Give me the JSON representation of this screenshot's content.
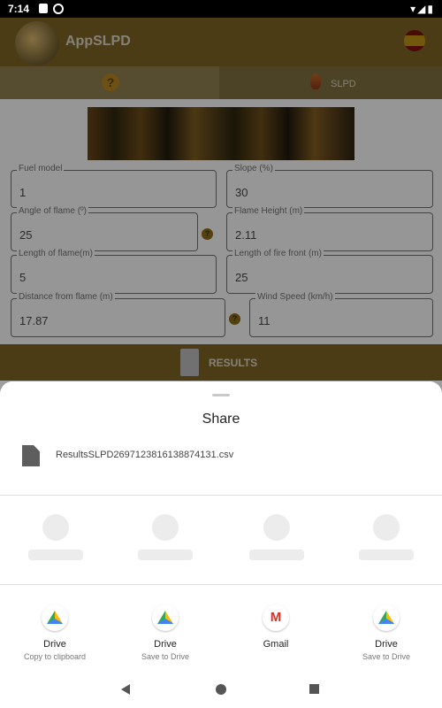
{
  "status_bar": {
    "time": "7:14"
  },
  "app": {
    "title": "AppSLPD",
    "tabs": [
      {
        "label": "?"
      },
      {
        "label": "SLPD"
      }
    ],
    "fields": [
      {
        "label": "Fuel model",
        "value": "1"
      },
      {
        "label": "Slope (%)",
        "value": "30"
      },
      {
        "label": "Angle of flame (º)",
        "value": "25"
      },
      {
        "label": "Flame Height (m)",
        "value": "2.11"
      },
      {
        "label": "Length of flame(m)",
        "value": "5"
      },
      {
        "label": "Length of fire front (m)",
        "value": "25"
      },
      {
        "label": "Distance from flame (m)",
        "value": "17.87"
      },
      {
        "label": "Wind Speed (km/h)",
        "value": "11"
      }
    ],
    "help_glyph": "?",
    "results_label": "RESULTS"
  },
  "share_sheet": {
    "title": "Share",
    "file_name": "ResultsSLPD2697123816138874131.csv",
    "targets": [
      {
        "name": "Drive",
        "subtitle": "Copy to clipboard",
        "icon": "google-drive-icon"
      },
      {
        "name": "Drive",
        "subtitle": "Save to Drive",
        "icon": "google-drive-icon"
      },
      {
        "name": "Gmail",
        "subtitle": "",
        "icon": "gmail-icon"
      },
      {
        "name": "Drive",
        "subtitle": "Save to Drive",
        "icon": "google-drive-icon"
      }
    ]
  }
}
